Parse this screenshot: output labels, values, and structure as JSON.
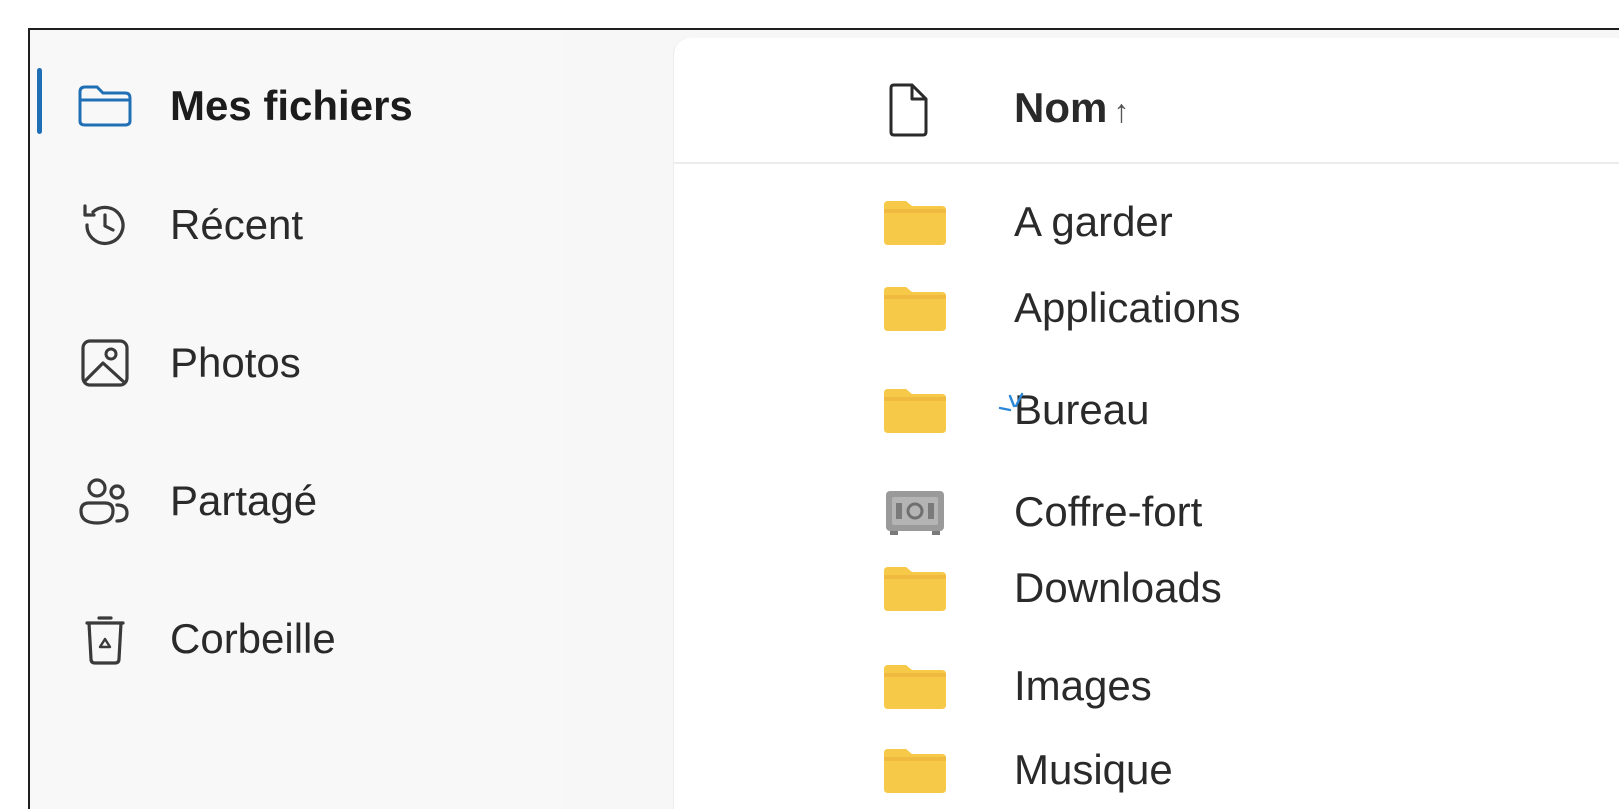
{
  "sidebar": {
    "items": [
      {
        "label": "Mes fichiers",
        "icon": "folder-icon",
        "active": true
      },
      {
        "label": "Récent",
        "icon": "history-icon",
        "active": false
      },
      {
        "label": "Photos",
        "icon": "image-icon",
        "active": false
      },
      {
        "label": "Partagé",
        "icon": "people-icon",
        "active": false
      },
      {
        "label": "Corbeille",
        "icon": "recycle-bin-icon",
        "active": false
      }
    ]
  },
  "file_list": {
    "header": {
      "type_icon": "document-icon",
      "name_column": "Nom",
      "sort_indicator": "↑"
    },
    "rows": [
      {
        "name": "A garder",
        "icon": "folder-icon"
      },
      {
        "name": "Applications",
        "icon": "folder-icon"
      },
      {
        "name": "Bureau",
        "icon": "folder-icon"
      },
      {
        "name": "Coffre-fort",
        "icon": "vault-icon"
      },
      {
        "name": "Downloads",
        "icon": "folder-icon"
      },
      {
        "name": "Images",
        "icon": "folder-icon"
      },
      {
        "name": "Musique",
        "icon": "folder-icon"
      }
    ]
  },
  "colors": {
    "accent": "#1f6fb5",
    "folder": "#f7c948",
    "folder_dark": "#e9b13a",
    "vault": "#8a8a8a"
  }
}
